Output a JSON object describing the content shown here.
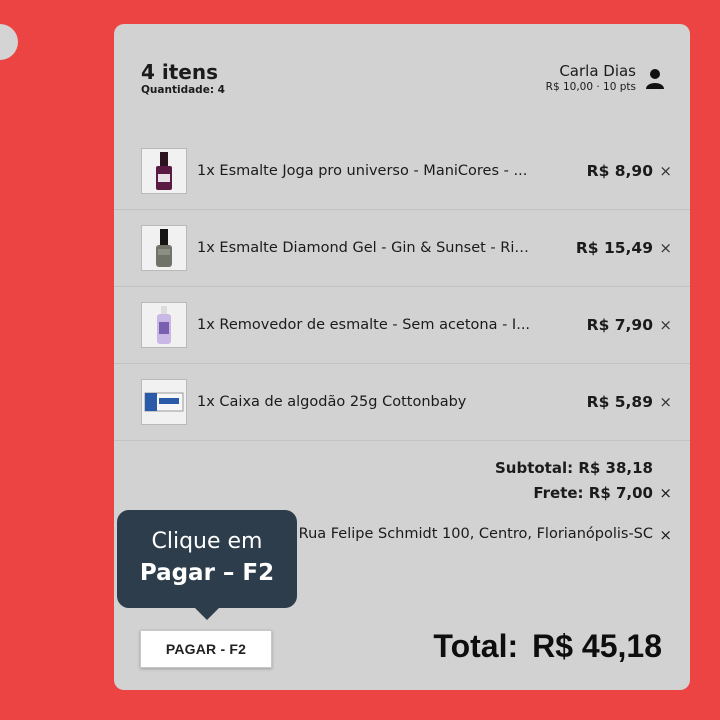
{
  "cart": {
    "items_count": "4 itens",
    "quantity_label": "Quantidade: 4"
  },
  "customer": {
    "name": "Carla Dias",
    "meta": "R$ 10,00  ·  10 pts",
    "icon": "user-icon"
  },
  "items": [
    {
      "name": "1x Esmalte Joga pro universo - ManiCores - ...",
      "price": "R$ 8,90",
      "remove": "×",
      "thumb": "nail-polish-purple"
    },
    {
      "name": "1x Esmalte Diamond Gel - Gin & Sunset - Ris...",
      "price": "R$ 15,49",
      "remove": "×",
      "thumb": "nail-polish-gray"
    },
    {
      "name": "1x Removedor de esmalte - Sem acetona - I...",
      "price": "R$ 7,90",
      "remove": "×",
      "thumb": "remover-bottle"
    },
    {
      "name": "1x Caixa de algodão 25g Cottonbaby",
      "price": "R$ 5,89",
      "remove": "×",
      "thumb": "cotton-box"
    }
  ],
  "summary": {
    "subtotal": "Subtotal: R$ 38,18",
    "frete": "Frete: R$ 7,00",
    "address": "Rua Felipe Schmidt 100, Centro, Florianópolis-SC",
    "remove": "×"
  },
  "actions": {
    "pay_label": "PAGAR - F2"
  },
  "total": {
    "label": "Total:",
    "value": "R$ 45,18"
  },
  "tooltip": {
    "line1": "Clique em",
    "line2": "Pagar – F2"
  },
  "colors": {
    "background": "#ec4343",
    "panel": "#d2d2d2",
    "tooltip": "#2e3d4c"
  }
}
